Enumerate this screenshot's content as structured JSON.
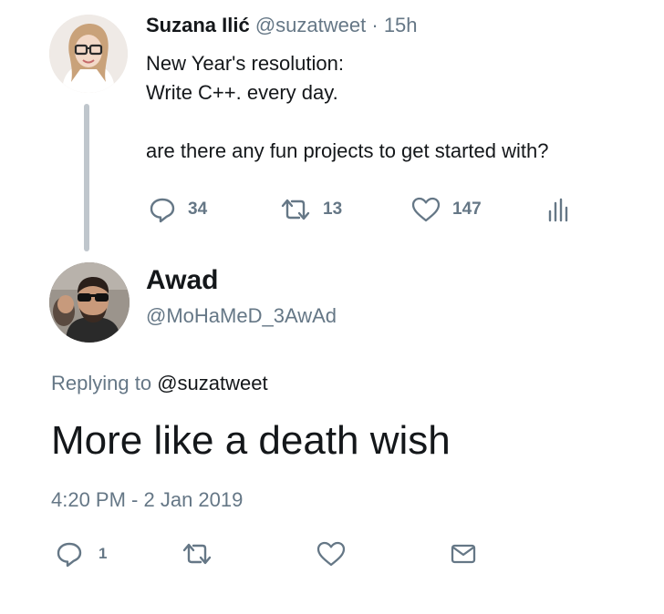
{
  "parent_tweet": {
    "display_name": "Suzana Ilić",
    "handle": "@suzatweet",
    "separator": "·",
    "time_ago": "15h",
    "text": "New Year's resolution:\nWrite C++. every day.\n\nare there any fun projects to get started with?",
    "actions": {
      "reply_icon": "reply-icon",
      "reply_count": "34",
      "retweet_icon": "retweet-icon",
      "retweet_count": "13",
      "like_icon": "heart-icon",
      "like_count": "147",
      "analytics_icon": "analytics-icon"
    }
  },
  "reply_tweet": {
    "display_name": "Awad",
    "handle": "@MoHaMeD_3AwAd",
    "replying_prefix": "Replying to",
    "replying_to": "@suzatweet",
    "text": "More like a death wish",
    "timestamp": "4:20 PM - 2 Jan 2019",
    "actions": {
      "reply_icon": "reply-icon",
      "reply_count": "1",
      "retweet_icon": "retweet-icon",
      "like_icon": "heart-icon",
      "dm_icon": "envelope-icon"
    }
  },
  "colors": {
    "text_primary": "#14171a",
    "text_secondary": "#657786",
    "thread_line": "#bfc6cc"
  }
}
